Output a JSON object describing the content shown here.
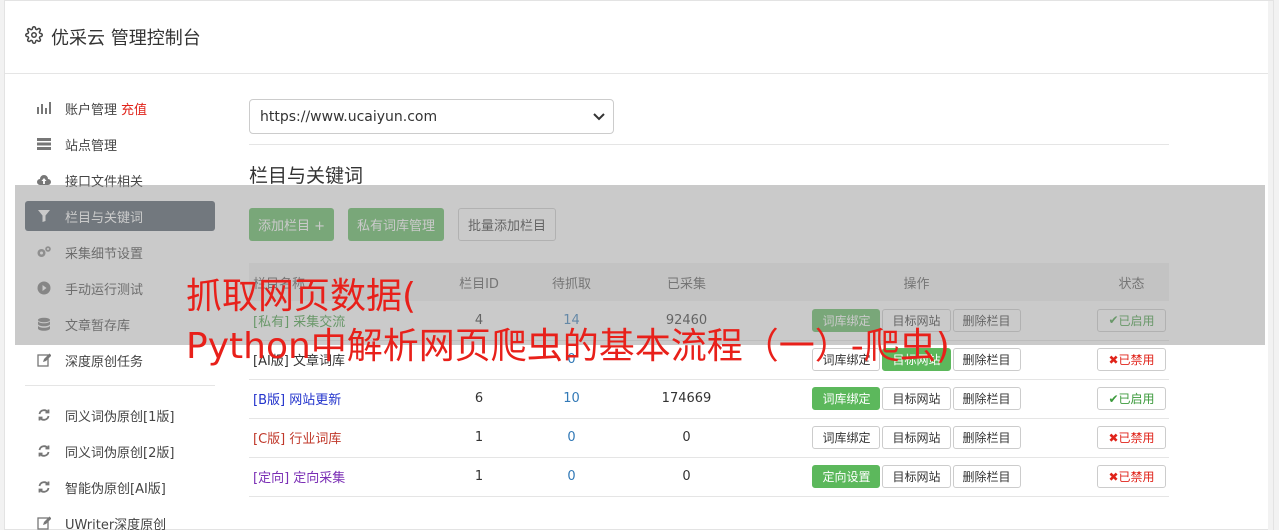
{
  "header": {
    "title": "优采云 管理控制台",
    "icon": "gear-icon"
  },
  "sidebar": {
    "items": [
      {
        "label": "账户管理",
        "extra": "充值",
        "icon": "bar-chart-icon"
      },
      {
        "label": "站点管理",
        "icon": "server-icon"
      },
      {
        "label": "接口文件相关",
        "icon": "cloud-upload-icon"
      },
      {
        "label": "栏目与关键词",
        "icon": "filter-icon",
        "active": true
      },
      {
        "label": "采集细节设置",
        "icon": "cogs-icon"
      },
      {
        "label": "手动运行测试",
        "icon": "play-icon"
      },
      {
        "label": "文章暂存库",
        "icon": "database-icon"
      },
      {
        "label": "深度原创任务",
        "icon": "edit-icon"
      }
    ],
    "items2": [
      {
        "label": "同义词伪原创[1版]",
        "icon": "refresh-icon"
      },
      {
        "label": "同义词伪原创[2版]",
        "icon": "refresh-icon"
      },
      {
        "label": "智能伪原创[AI版]",
        "icon": "refresh-icon"
      },
      {
        "label": "UWriter深度原创",
        "icon": "edit-icon"
      }
    ]
  },
  "site_select": {
    "value": "https://www.ucaiyun.com"
  },
  "section": {
    "title": "栏目与关键词"
  },
  "buttons": {
    "add": "添加栏目 +",
    "private": "私有词库管理",
    "batch": "批量添加栏目"
  },
  "table": {
    "headers": [
      "栏目名称",
      "栏目ID",
      "待抓取",
      "已采集",
      "操作",
      "状态"
    ],
    "rows": [
      {
        "tag": "[私有]",
        "name": "采集交流",
        "id": "4",
        "pending": "14",
        "collected": "92460",
        "op1": "词库绑定",
        "op2": "目标网站",
        "op3": "删除栏目",
        "status": "已启用",
        "tagColor": "#3c9a3c"
      },
      {
        "tag": "[AI版]",
        "name": "文章词库",
        "id": "",
        "pending": "0",
        "collected": "",
        "op1": "词库绑定",
        "op2": "目标网站",
        "op3": "删除栏目",
        "status": "已禁用",
        "tagColor": "#333333"
      },
      {
        "tag": "[B版]",
        "name": "网站更新",
        "id": "6",
        "pending": "10",
        "collected": "174669",
        "op1": "词库绑定",
        "op2": "目标网站",
        "op3": "删除栏目",
        "status": "已启用",
        "tagColor": "#2233cc"
      },
      {
        "tag": "[C版]",
        "name": "行业词库",
        "id": "1",
        "pending": "0",
        "collected": "0",
        "op1": "词库绑定",
        "op2": "目标网站",
        "op3": "删除栏目",
        "status": "已禁用",
        "tagColor": "#c0392b"
      },
      {
        "tag": "[定向]",
        "name": "定向采集",
        "id": "1",
        "pending": "0",
        "collected": "0",
        "op1": "定向设置",
        "op2": "目标网站",
        "op3": "删除栏目",
        "status": "已禁用",
        "tagColor": "#7b2fb5"
      }
    ]
  },
  "overlay": {
    "line1": "抓取网页数据(",
    "line2": "Python中解析网页爬虫的基本流程（一）-爬虫)"
  }
}
